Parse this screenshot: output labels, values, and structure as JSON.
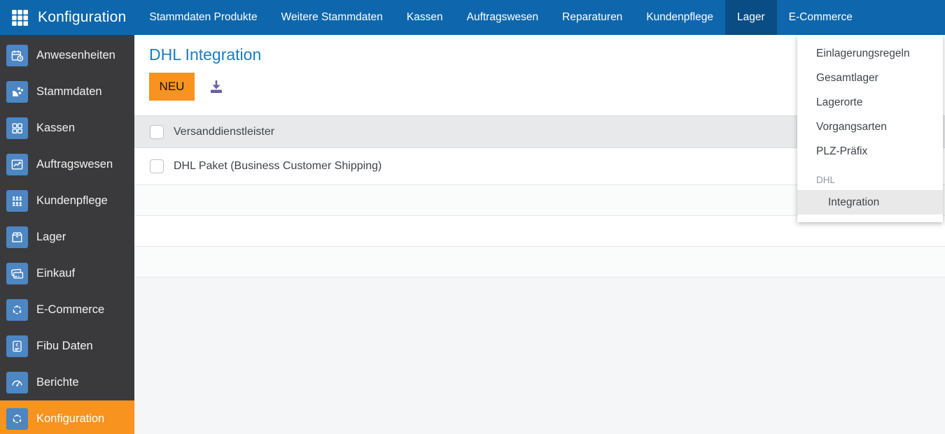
{
  "topnav": {
    "title": "Konfiguration",
    "items": [
      {
        "label": "Stammdaten Produkte",
        "active": false
      },
      {
        "label": "Weitere Stammdaten",
        "active": false
      },
      {
        "label": "Kassen",
        "active": false
      },
      {
        "label": "Auftragswesen",
        "active": false
      },
      {
        "label": "Reparaturen",
        "active": false
      },
      {
        "label": "Kundenpflege",
        "active": false
      },
      {
        "label": "Lager",
        "active": true
      },
      {
        "label": "E-Commerce",
        "active": false
      }
    ]
  },
  "sidebar": {
    "items": [
      {
        "label": "Anwesenheiten",
        "icon": "calendar-clock-icon",
        "active": false
      },
      {
        "label": "Stammdaten",
        "icon": "pie-blocks-icon",
        "active": false
      },
      {
        "label": "Kassen",
        "icon": "grid-squares-icon",
        "active": false
      },
      {
        "label": "Auftragswesen",
        "icon": "chart-line-icon",
        "active": false
      },
      {
        "label": "Kundenpflege",
        "icon": "people-group-icon",
        "active": false
      },
      {
        "label": "Lager",
        "icon": "package-icon",
        "active": false
      },
      {
        "label": "Einkauf",
        "icon": "credit-card-icon",
        "active": false
      },
      {
        "label": "E-Commerce",
        "icon": "hub-icon",
        "active": false
      },
      {
        "label": "Fibu Daten",
        "icon": "euro-document-icon",
        "active": false
      },
      {
        "label": "Berichte",
        "icon": "gauge-icon",
        "active": false
      },
      {
        "label": "Konfiguration",
        "icon": "hub-icon",
        "active": true
      }
    ]
  },
  "main": {
    "title": "DHL Integration",
    "new_button_label": "NEU",
    "download_icon": "download-icon",
    "table": {
      "header": "Versanddienstleister",
      "rows": [
        {
          "label": "DHL Paket (Business Customer Shipping)",
          "checked": false
        }
      ]
    }
  },
  "dropdown": {
    "items": [
      {
        "label": "Einlagerungsregeln"
      },
      {
        "label": "Gesamtlager"
      },
      {
        "label": "Lagerorte"
      },
      {
        "label": "Vorgangsarten"
      },
      {
        "label": "PLZ-Präfix"
      }
    ],
    "group_label": "DHL",
    "group_items": [
      {
        "label": "Integration",
        "active": true
      }
    ]
  },
  "colors": {
    "nav_blue": "#0e67ac",
    "nav_active_blue": "#0a4d85",
    "sidebar_dark": "#3a3a3c",
    "icon_tile_blue": "#4c86c3",
    "accent_orange": "#f7931e",
    "heading_blue": "#1b7dc0",
    "download_purple": "#6a5fa8",
    "table_header_bg": "#e7e9ea",
    "dropdown_highlight": "#e9e9e9"
  }
}
